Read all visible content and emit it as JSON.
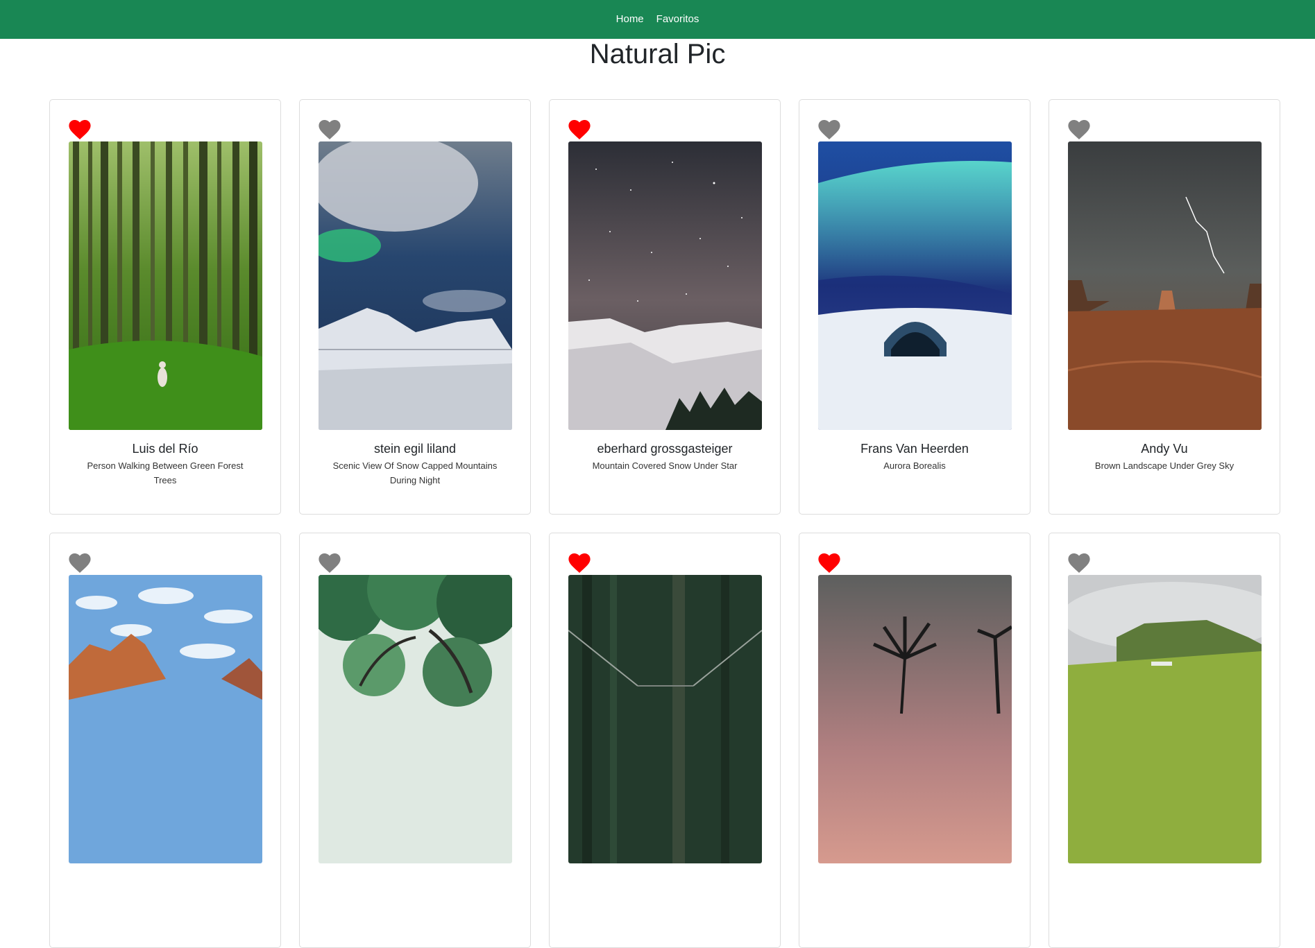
{
  "nav": {
    "home_label": "Home",
    "favorites_label": "Favoritos",
    "background": "#198754"
  },
  "page": {
    "title": "Natural Pic"
  },
  "colors": {
    "heart_liked": "#ff0000",
    "heart_unliked": "#808080"
  },
  "photos": [
    {
      "author": "Luis del Río",
      "description": "Person Walking Between Green Forest Trees",
      "liked": true,
      "theme": "green-forest"
    },
    {
      "author": "stein egil liland",
      "description": "Scenic View Of Snow Capped Mountains During Night",
      "liked": false,
      "theme": "aurora-mountains"
    },
    {
      "author": "eberhard grossgasteiger",
      "description": "Mountain Covered Snow Under Star",
      "liked": true,
      "theme": "starry-mountain"
    },
    {
      "author": "Frans Van Heerden",
      "description": "Aurora Borealis",
      "liked": false,
      "theme": "aurora-igloo"
    },
    {
      "author": "Andy Vu",
      "description": "Brown Landscape Under Grey Sky",
      "liked": false,
      "theme": "desert-storm"
    },
    {
      "author": "",
      "description": "",
      "liked": false,
      "theme": "blue-sky-peaks"
    },
    {
      "author": "",
      "description": "",
      "liked": false,
      "theme": "tree-canopy"
    },
    {
      "author": "",
      "description": "",
      "liked": true,
      "theme": "forest-bridge"
    },
    {
      "author": "",
      "description": "",
      "liked": true,
      "theme": "palm-sunset"
    },
    {
      "author": "",
      "description": "",
      "liked": false,
      "theme": "green-hill"
    }
  ]
}
